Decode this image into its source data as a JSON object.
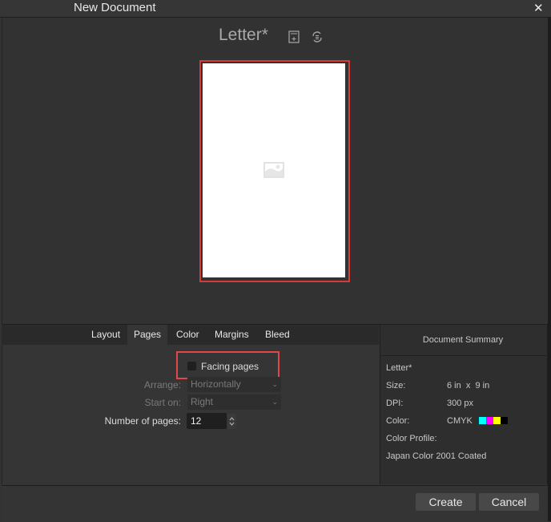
{
  "window": {
    "title": "New Document",
    "close_icon": "close-icon"
  },
  "preview": {
    "document_name": "Letter*",
    "icons": [
      "document-add-icon",
      "orientation-toggle-icon"
    ],
    "page_placeholder_icon": "image-placeholder-icon",
    "page_color": "#ffffff",
    "highlight_color": "#d43b3b"
  },
  "tabs": [
    {
      "label": "Layout",
      "active": false
    },
    {
      "label": "Pages",
      "active": true
    },
    {
      "label": "Color",
      "active": false
    },
    {
      "label": "Margins",
      "active": false
    },
    {
      "label": "Bleed",
      "active": false
    }
  ],
  "pages_settings": {
    "facing_pages": {
      "label": "Facing pages",
      "checked": false
    },
    "arrange": {
      "label": "Arrange:",
      "value": "Horizontally",
      "enabled": false
    },
    "start_on": {
      "label": "Start on:",
      "value": "Right",
      "enabled": false
    },
    "number_of_pages": {
      "label": "Number of pages:",
      "value": "12"
    }
  },
  "summary": {
    "header": "Document Summary",
    "name": "Letter*",
    "size_label": "Size:",
    "size_value": "6 in  x  9 in",
    "dpi_label": "DPI:",
    "dpi_value": "300 px",
    "color_label": "Color:",
    "color_value": "CMYK",
    "color_swatches": [
      "#00ffff",
      "#ff00ff",
      "#ffff00",
      "#000000"
    ],
    "profile_label": "Color Profile:",
    "profile_value": "Japan Color 2001 Coated"
  },
  "buttons": {
    "create": "Create",
    "cancel": "Cancel"
  }
}
